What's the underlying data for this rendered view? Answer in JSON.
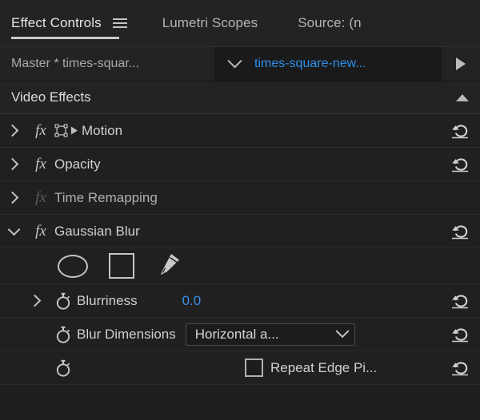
{
  "panel": {
    "tabs": [
      {
        "label": "Effect Controls",
        "active": true,
        "has_menu_icon": true
      },
      {
        "label": "Lumetri Scopes",
        "active": false,
        "has_menu_icon": false
      },
      {
        "label": "Source: (n",
        "active": false,
        "has_menu_icon": false
      }
    ],
    "menu_icon": "hamburger-menu-icon"
  },
  "selector": {
    "master_label": "Master * times-squar...",
    "dropdown_icon": "chevron-down-icon",
    "clip_label": "times-square-new...",
    "clip_color": "#2f8fe8",
    "play_icon": "play-triangle-icon"
  },
  "section": {
    "title": "Video Effects",
    "collapse_icon": "caret-up-icon"
  },
  "effects": [
    {
      "name": "Motion",
      "disclosure": "chevron-right-icon",
      "expanded": false,
      "fx_icon": "fx-icon",
      "fx_dim": false,
      "extra_icon": "transform-box-icon",
      "has_reset": true,
      "reset_icon": "reset-icon"
    },
    {
      "name": "Opacity",
      "disclosure": "chevron-right-icon",
      "expanded": false,
      "fx_icon": "fx-icon",
      "fx_dim": false,
      "extra_icon": null,
      "has_reset": true,
      "reset_icon": "reset-icon"
    },
    {
      "name": "Time Remapping",
      "disclosure": "chevron-right-icon",
      "expanded": false,
      "fx_icon": "fx-icon",
      "fx_dim": true,
      "extra_icon": null,
      "has_reset": false,
      "reset_icon": null
    },
    {
      "name": "Gaussian Blur",
      "disclosure": "chevron-down-icon",
      "expanded": true,
      "fx_icon": "fx-icon",
      "fx_dim": false,
      "extra_icon": null,
      "has_reset": true,
      "reset_icon": "reset-icon"
    }
  ],
  "mask_tools": [
    {
      "icon": "ellipse-mask-icon",
      "label": "Create ellipse mask"
    },
    {
      "icon": "rectangle-mask-icon",
      "label": "Create 4-point polygon mask"
    },
    {
      "icon": "pen-mask-icon",
      "label": "Create free draw bezier"
    }
  ],
  "properties": [
    {
      "kind": "number",
      "label": "Blurriness",
      "value": "0.0",
      "disclosure": "chevron-right-icon",
      "has_disclosure": true,
      "stopwatch_icon": "stopwatch-icon",
      "has_reset": true,
      "reset_icon": "reset-icon"
    },
    {
      "kind": "dropdown",
      "label": "Blur Dimensions",
      "value": "Horizontal a...",
      "has_disclosure": false,
      "stopwatch_icon": "stopwatch-icon",
      "dropdown_icon": "chevron-down-icon",
      "has_reset": true,
      "reset_icon": "reset-icon"
    },
    {
      "kind": "checkbox",
      "label": "Repeat Edge Pi...",
      "checked": false,
      "has_disclosure": false,
      "stopwatch_icon": "stopwatch-icon",
      "checkbox_icon": "checkbox-unchecked-icon",
      "has_reset": true,
      "reset_icon": "reset-icon"
    }
  ]
}
